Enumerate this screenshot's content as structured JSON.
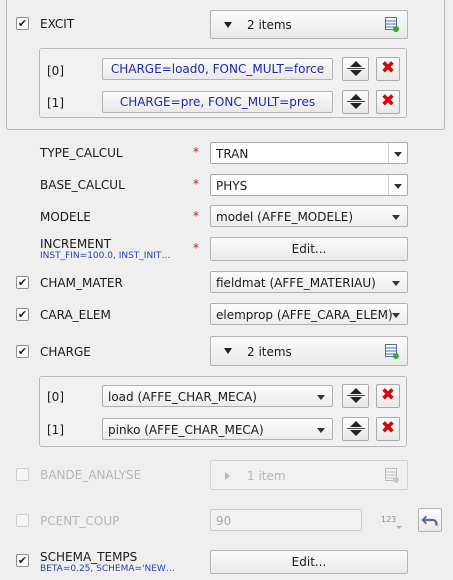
{
  "excit": {
    "label": "EXCIT",
    "checked": true,
    "items_label": "2 items",
    "rows": [
      {
        "index": "[0]",
        "value": "CHARGE=load0, FONC_MULT=force"
      },
      {
        "index": "[1]",
        "value": "CHARGE=pre, FONC_MULT=pres"
      }
    ]
  },
  "type_calcul": {
    "label": "TYPE_CALCUL",
    "value": "TRAN"
  },
  "base_calcul": {
    "label": "BASE_CALCUL",
    "value": "PHYS"
  },
  "modele": {
    "label": "MODELE",
    "value": "model (AFFE_MODELE)"
  },
  "increment": {
    "label": "INCREMENT",
    "summary": "INST_FIN=100.0, INST_INIT…",
    "button": "Edit..."
  },
  "cham_mater": {
    "label": "CHAM_MATER",
    "checked": true,
    "value": "fieldmat (AFFE_MATERIAU)"
  },
  "cara_elem": {
    "label": "CARA_ELEM",
    "checked": true,
    "value": "elemprop (AFFE_CARA_ELEM)"
  },
  "charge": {
    "label": "CHARGE",
    "checked": true,
    "items_label": "2 items",
    "rows": [
      {
        "index": "[0]",
        "value": "load (AFFE_CHAR_MECA)"
      },
      {
        "index": "[1]",
        "value": "pinko (AFFE_CHAR_MECA)"
      }
    ]
  },
  "bande_analyse": {
    "label": "BANDE_ANALYSE",
    "checked": false,
    "items_label": "1 item"
  },
  "pcent_coup": {
    "label": "PCENT_COUP",
    "checked": false,
    "value": "90",
    "type_hint": "123"
  },
  "schema_temps": {
    "label": "SCHEMA_TEMPS",
    "checked": true,
    "summary": "BETA=0.25, SCHEMA='NEW…",
    "button": "Edit..."
  },
  "required_marker": "*",
  "check_mark": "✔",
  "delete_glyph": "✖",
  "colors": {
    "required": "#d01818",
    "delete": "#d20a0a",
    "link_text": "#1c2aa8",
    "summary_text": "#2a3fa8"
  }
}
